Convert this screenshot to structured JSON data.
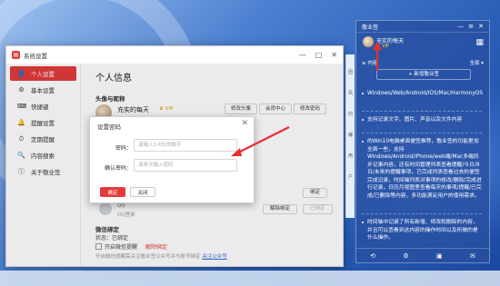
{
  "window": {
    "title": "系统设置",
    "logo_glyph": "▤",
    "controls": [
      "—",
      "□",
      "✕"
    ]
  },
  "sidebar": {
    "items": [
      {
        "icon": "👤",
        "label": "个人设置",
        "active": true
      },
      {
        "icon": "⚙",
        "label": "基本设置"
      },
      {
        "icon": "⌨",
        "label": "快捷键"
      },
      {
        "icon": "🔔",
        "label": "提醒设置"
      },
      {
        "icon": "⏱",
        "label": "定期提醒"
      },
      {
        "icon": "🔍",
        "label": "内容搜索"
      },
      {
        "icon": "ⓘ",
        "label": "关于敬业签"
      }
    ]
  },
  "profile": {
    "page_title": "个人信息",
    "section_avatar": "头像与昵称",
    "nickname": "充实的每天",
    "vip": "♛ VIP",
    "uid_partial": "号码",
    "btn_change_avatar": "修改头像",
    "btn_vip_center": "会员中心",
    "btn_change_password": "修改密码",
    "partial_b": "账",
    "partial_c": "手",
    "btn_bind1": "绑定",
    "btn_unbind": "解除绑定",
    "btn_bind2": "已绑定",
    "wechat_name": "QQ",
    "wechat_sub": "QQ登录",
    "wx_title": "微信绑定",
    "wx_status": "状态：已绑定",
    "wx_checkbox": "开启微信提醒",
    "wx_unbind": "解除绑定",
    "wx_hint": "开启微信提醒需关注敬业签公众号并与账号绑定",
    "wx_link": "关注公众号"
  },
  "dialog": {
    "title": "设置密码",
    "close": "✕",
    "pwd_label": "密码：",
    "pwd_placeholder": "请输入1-6位的数字",
    "confirm_label": "确认密码：",
    "confirm_placeholder": "请再次输入密码",
    "ok": "确定",
    "cancel": "关闭"
  },
  "widget": {
    "app": "敬业签",
    "top_icons": [
      "—",
      "≡",
      "✕"
    ],
    "nickname": "充实的每天",
    "vip": "♛ VIP",
    "calendar_icon": "▦",
    "filter_left": "≡ 内容",
    "filter_right": "全部 ▾",
    "new_label": "+ 新增敬业签",
    "items": [
      "Windows/Web/Android/iOS/Mac/HarmonyOS",
      "支持记录文字、图片、声音以及文件内容",
      "的Win10电脑桌面便签推荐，敬业签的功能更加全面一些，支持Windows/Android/iPhone/web端/Mac多端同步记事内容，还有时间管理列表查看提醒/今日/8日/未来的提醒事项，已完成列表查看过去的便签完成记录，时间轴列表对事项的修改/删除/完成进行记录，日历月视图里查看每天的事项/提醒/已完成/已删除等内容，多功能满足用户的使用需求。",
      "时间轴中记录了所有新增、修改和删除的内容，并且可以查看到这内容的操作时间以及所做的是什么操作。"
    ],
    "bottom_icons": [
      "⟲",
      "⚙",
      "▣",
      "✉"
    ]
  },
  "edge_tabs": [
    "团",
    "风",
    "内",
    "编",
    "用",
    "户"
  ]
}
